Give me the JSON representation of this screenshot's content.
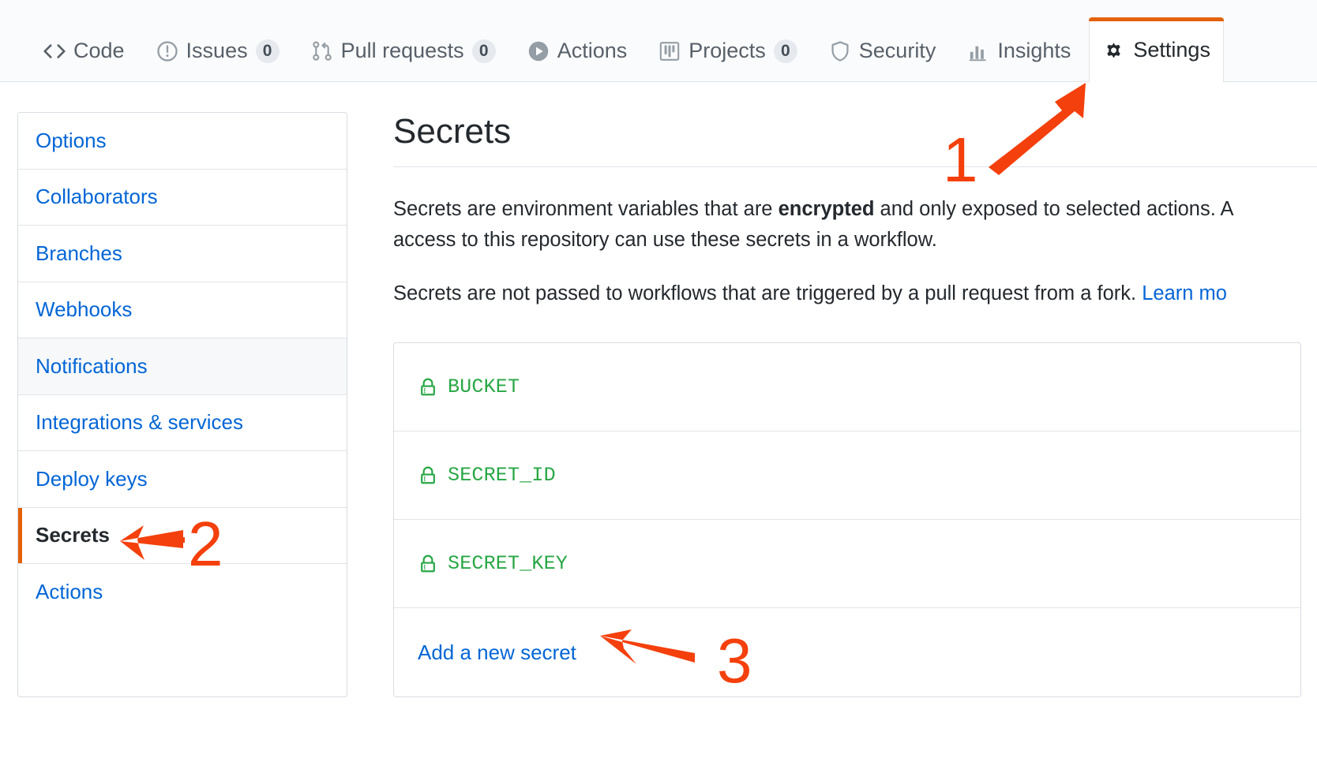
{
  "repo_nav": {
    "tabs": [
      {
        "label": "Code",
        "icon": "code-icon",
        "count": null,
        "selected": false
      },
      {
        "label": "Issues",
        "icon": "issue-opened-icon",
        "count": "0",
        "selected": false
      },
      {
        "label": "Pull requests",
        "icon": "git-pull-request-icon",
        "count": "0",
        "selected": false
      },
      {
        "label": "Actions",
        "icon": "play-icon",
        "count": null,
        "selected": false
      },
      {
        "label": "Projects",
        "icon": "project-icon",
        "count": "0",
        "selected": false
      },
      {
        "label": "Security",
        "icon": "shield-icon",
        "count": null,
        "selected": false
      },
      {
        "label": "Insights",
        "icon": "graph-icon",
        "count": null,
        "selected": false
      },
      {
        "label": "Settings",
        "icon": "gear-icon",
        "count": null,
        "selected": true
      }
    ]
  },
  "sidebar": {
    "items": [
      {
        "label": "Options",
        "state": "normal"
      },
      {
        "label": "Collaborators",
        "state": "normal"
      },
      {
        "label": "Branches",
        "state": "normal"
      },
      {
        "label": "Webhooks",
        "state": "normal"
      },
      {
        "label": "Notifications",
        "state": "hovered"
      },
      {
        "label": "Integrations & services",
        "state": "normal"
      },
      {
        "label": "Deploy keys",
        "state": "normal"
      },
      {
        "label": "Secrets",
        "state": "selected"
      },
      {
        "label": "Actions",
        "state": "normal"
      }
    ]
  },
  "main": {
    "title": "Secrets",
    "paragraph1_part1": "Secrets are environment variables that are ",
    "paragraph1_bold": "encrypted",
    "paragraph1_part2": " and only exposed to selected actions. A",
    "paragraph1_line2": "access to this repository can use these secrets in a workflow.",
    "paragraph2_text": "Secrets are not passed to workflows that are triggered by a pull request from a fork. ",
    "paragraph2_link": "Learn mo",
    "secrets": [
      {
        "name": "BUCKET",
        "icon": "lock-icon"
      },
      {
        "name": "SECRET_ID",
        "icon": "lock-icon"
      },
      {
        "name": "SECRET_KEY",
        "icon": "lock-icon"
      }
    ],
    "add_secret_label": "Add a new secret"
  },
  "annotations": {
    "color": "#f4400c",
    "markers": [
      {
        "number": "1",
        "points_to": "Settings tab"
      },
      {
        "number": "2",
        "points_to": "Secrets sidebar item"
      },
      {
        "number": "3",
        "points_to": "Add a new secret link"
      }
    ]
  },
  "colors": {
    "link_blue": "#0366d6",
    "secret_green": "#28a745",
    "accent_orange": "#e36209",
    "annotation_orange": "#f4400c",
    "text_dark": "#24292e",
    "nav_bg": "#fafbfc",
    "border": "#e1e4e8"
  }
}
